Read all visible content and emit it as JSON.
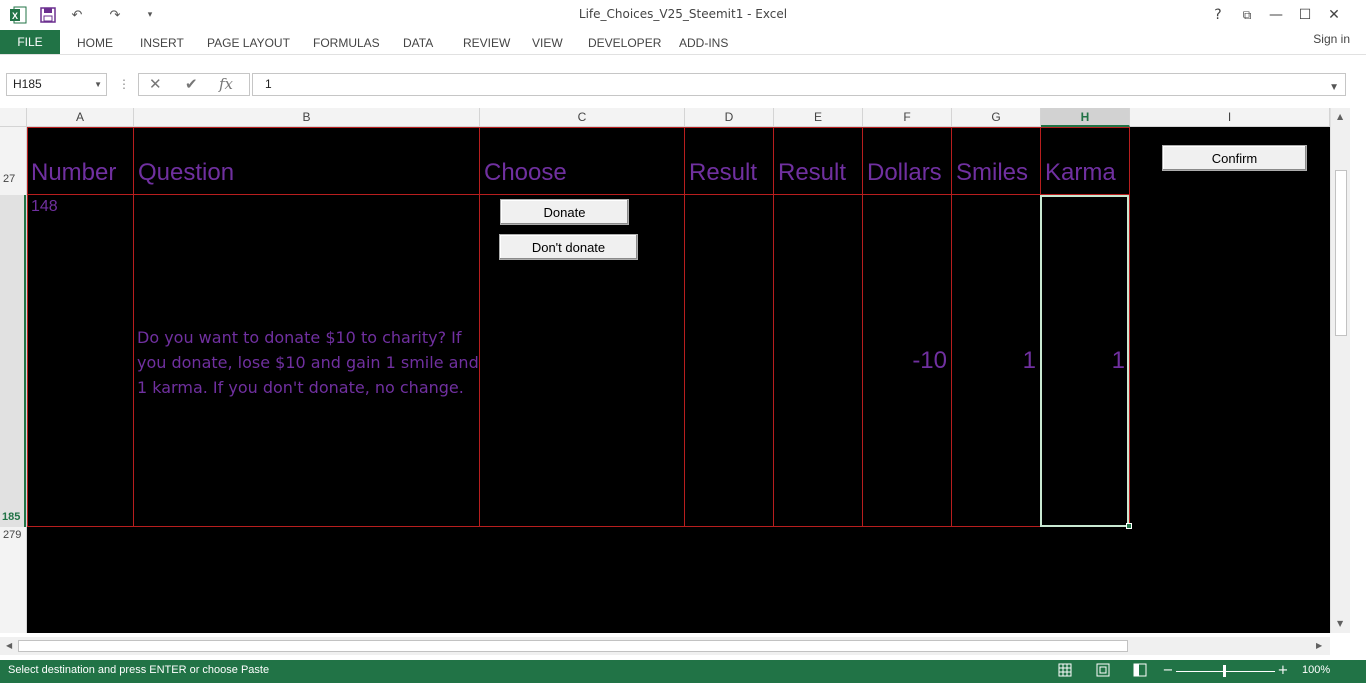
{
  "window": {
    "title": "Life_Choices_V25_Steemit1 - Excel",
    "help": "?",
    "restore_ribbon": "⧉",
    "maximize": "☐",
    "close": "✕"
  },
  "qat": {
    "undo": "↶",
    "redo": "↷",
    "customize": "▾"
  },
  "ribbon": {
    "file_label": "FILE",
    "tabs": [
      "HOME",
      "INSERT",
      "PAGE LAYOUT",
      "FORMULAS",
      "DATA",
      "REVIEW",
      "VIEW",
      "DEVELOPER",
      "ADD-INS"
    ],
    "signin": "Sign in"
  },
  "formula_bar": {
    "name_box": "H185",
    "cancel_icon": "✕",
    "enter_icon": "✔",
    "fx_label": "fx",
    "value": "1"
  },
  "columns": [
    "A",
    "B",
    "C",
    "D",
    "E",
    "F",
    "G",
    "H",
    "I"
  ],
  "selected_column": "H",
  "rows": {
    "header_row": "27",
    "data_row": "185",
    "next_row": "279"
  },
  "sheet": {
    "headers": {
      "number": "Number",
      "question": "Question",
      "choose": "Choose",
      "result1": "Result",
      "result2": "Result",
      "dollars": "Dollars",
      "smiles": "Smiles",
      "karma": "Karma"
    },
    "row": {
      "number": "148",
      "question": "Do you want to donate $10 to charity? If you donate, lose $10 and gain 1 smile and 1 karma. If you don't donate, no change.",
      "dollars": "-10",
      "smiles": "1",
      "karma": "1"
    },
    "buttons": {
      "donate": "Donate",
      "dont_donate": "Don't donate",
      "confirm": "Confirm"
    },
    "colors": {
      "background": "#000000",
      "text": "#7030a0",
      "grid": "#b81e1e"
    }
  },
  "status_bar": {
    "message": "Select destination and press ENTER or choose Paste",
    "zoom_out": "−",
    "zoom_in": "+",
    "zoom": "100%",
    "zoom_fraction": 0.5,
    "accent": "#217346"
  }
}
